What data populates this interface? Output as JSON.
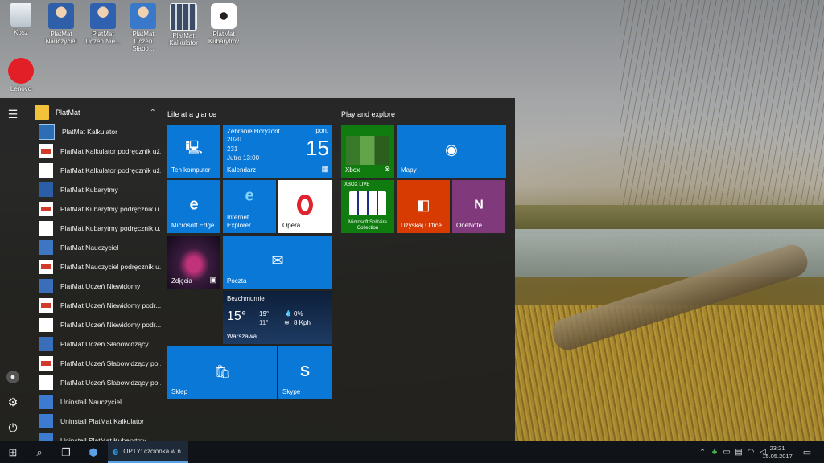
{
  "desktop_icons": [
    {
      "label": "Kosz",
      "icon": "recycle-bin-icon"
    },
    {
      "label": "PlatMat Nauczyciel",
      "icon": "teacher-icon"
    },
    {
      "label": "PlatMat Uczeń Nie...",
      "icon": "student-blind-icon"
    },
    {
      "label": "PlatMat Uczeń Słabo...",
      "icon": "student-lowvision-icon"
    },
    {
      "label": "PlatMat Kalkulator",
      "icon": "calculator-icon"
    },
    {
      "label": "PlatMat Kubarytmy",
      "icon": "cubarithm-icon"
    },
    {
      "label": "Lenovo",
      "icon": "lenovo-icon"
    }
  ],
  "start_menu": {
    "group_label": "PlatMat",
    "items": [
      {
        "label": "PlatMat Kalkulator",
        "icon": "calc"
      },
      {
        "label": "PlatMat Kalkulator podręcznik uż...",
        "icon": "pdf"
      },
      {
        "label": "PlatMat Kalkulator podręcznik uż...",
        "icon": "doc"
      },
      {
        "label": "PlatMat Kubarytmy",
        "icon": "kub"
      },
      {
        "label": "PlatMat Kubarytmy podręcznik u...",
        "icon": "pdf"
      },
      {
        "label": "PlatMat Kubarytmy podręcznik u...",
        "icon": "doc"
      },
      {
        "label": "PlatMat Nauczyciel",
        "icon": "naucz"
      },
      {
        "label": "PlatMat Nauczyciel podręcznik u...",
        "icon": "pdf"
      },
      {
        "label": "PlatMat Uczeń Niewidomy",
        "icon": "uczen"
      },
      {
        "label": "PlatMat Uczeń Niewidomy podr...",
        "icon": "pdf"
      },
      {
        "label": "PlatMat Uczeń Niewidomy podr...",
        "icon": "doc"
      },
      {
        "label": "PlatMat Uczeń Słabowidzący",
        "icon": "uczen"
      },
      {
        "label": "PlatMat Uczeń Słabowidzący po...",
        "icon": "pdf"
      },
      {
        "label": "PlatMat Uczeń Słabowidzący po...",
        "icon": "doc"
      },
      {
        "label": "Uninstall Nauczyciel",
        "icon": "uninst"
      },
      {
        "label": "Uninstall PlatMat Kalkulator",
        "icon": "uninst"
      },
      {
        "label": "Uninstall PlatMat Kubarytmy",
        "icon": "uninst"
      }
    ],
    "section_left": "Life at a glance",
    "section_right": "Play and explore",
    "tiles": {
      "computer": "Ten komputer",
      "calendar_event": "Zebranie Horyzont 2020",
      "calendar_sub1": "231",
      "calendar_sub2": "Jutro 13:00",
      "calendar_day": "pon.",
      "calendar_date": "15",
      "calendar_label": "Kalendarz",
      "edge": "Microsoft Edge",
      "ie": "Internet Explorer",
      "opera": "Opera",
      "photos": "Zdjęcia",
      "mail": "Poczta",
      "weather_cond": "Bezchmurnie",
      "weather_temp": "15°",
      "weather_hi": "19°",
      "weather_lo": "11°",
      "weather_precip": "0%",
      "weather_wind": "8 Kph",
      "weather_city": "Warszawa",
      "store": "Sklep",
      "skype": "Skype",
      "xbox": "Xbox",
      "maps": "Mapy",
      "solitaire_badge": "XBOX LIVE",
      "solitaire": "Microsoft Solitaire Collection",
      "office": "Uzyskaj Office",
      "onenote": "OneNote"
    }
  },
  "taskbar": {
    "active_window": "OPTY: czcionka w n...",
    "time": "23:21",
    "date": "15.05.2017"
  },
  "colors": {
    "tile_blue": "#0a78d7",
    "xbox_green": "#107c10",
    "office_orange": "#d83b01",
    "onenote_purple": "#80397b"
  }
}
